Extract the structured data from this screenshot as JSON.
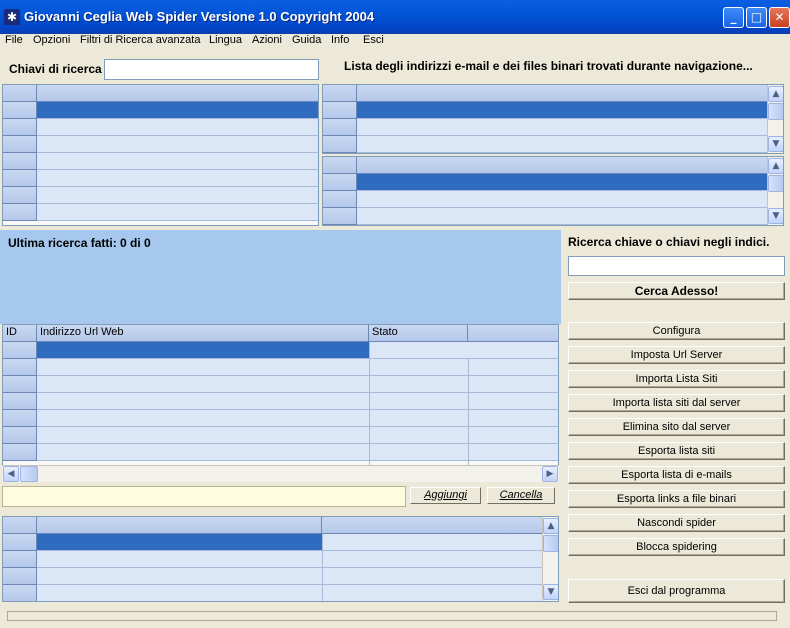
{
  "window": {
    "title": "Giovanni Ceglia Web Spider Versione 1.0 Copyright 2004",
    "minimize": "_",
    "maximize": "□",
    "close": "✕"
  },
  "menu": [
    "File",
    "Opzioni",
    "Filtri di Ricerca avanzata",
    "Lingua",
    "Azioni",
    "Guida",
    "Info",
    "Esci"
  ],
  "search": {
    "label": "Chiavi di ricerca",
    "value": ""
  },
  "list_heading": "Lista degli indirizzi e-mail e dei files binari trovati durante navigazione...",
  "info": {
    "text": "Ultima ricerca fatti: 0 di 0"
  },
  "url_table": {
    "columns": [
      "ID",
      "Indirizzo Url Web",
      "Stato",
      ""
    ]
  },
  "right_panel": {
    "label": "Ricerca chiave o chiavi negli indici.",
    "input_value": "",
    "search_button": "Cerca Adesso!",
    "buttons": [
      "Configura",
      "Imposta Url Server",
      "Importa Lista Siti",
      "Importa lista siti dal server",
      "Elimina sito dal server",
      "Esporta lista siti",
      "Esporta lista di e-mails",
      "Esporta links a file binari",
      "Nascondi spider",
      "Blocca spidering"
    ],
    "exit_button": "Esci dal programma"
  },
  "url_entry": {
    "value": "",
    "add_button": "Aggiungi",
    "cancel_button": "Cancella"
  },
  "icons": {
    "app": "spider-icon",
    "scroll_up": "▲",
    "scroll_down": "▼",
    "scroll_left": "◀",
    "scroll_right": "▶"
  }
}
